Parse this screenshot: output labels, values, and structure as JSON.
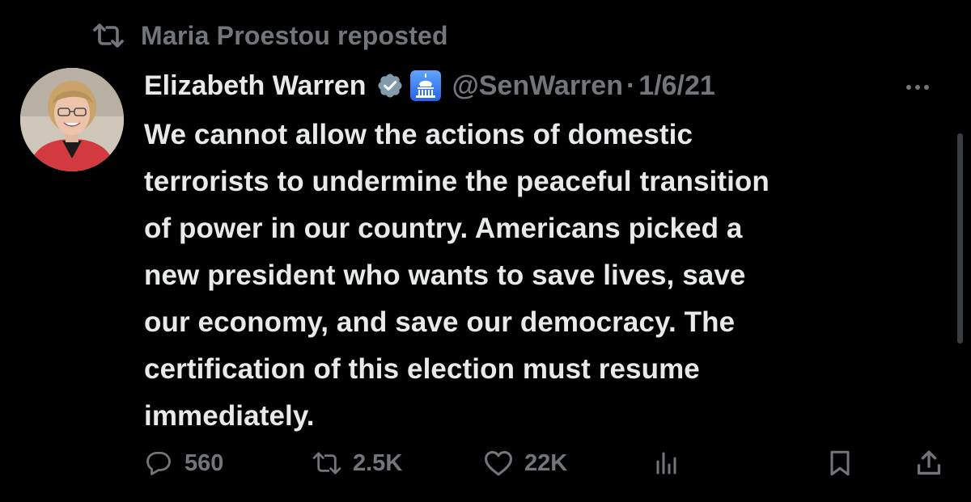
{
  "repost": {
    "icon": "repost-icon",
    "text": "Maria Proestou reposted"
  },
  "author": {
    "display_name": "Elizabeth Warren",
    "verified_icon": "verified-badge-icon",
    "affiliation_icon": "capitol-building-icon",
    "handle": "@SenWarren",
    "separator": "·",
    "date": "1/6/21"
  },
  "tweet": {
    "lines": [
      "We cannot allow the actions of domestic",
      "terrorists to undermine the peaceful transition",
      "of power in our country. Americans picked a",
      "new president who wants to save lives, save",
      "our economy, and save our democracy. The",
      "certification of this election must resume",
      "immediately."
    ]
  },
  "actions": {
    "reply": {
      "icon": "reply-icon",
      "count": "560"
    },
    "repost": {
      "icon": "repost-icon",
      "count": "2.5K"
    },
    "like": {
      "icon": "heart-icon",
      "count": "22K"
    },
    "views": {
      "icon": "views-icon"
    },
    "bookmark": {
      "icon": "bookmark-icon"
    },
    "share": {
      "icon": "share-icon"
    }
  },
  "colors": {
    "background": "#000000",
    "primary_text": "#e7e9ea",
    "secondary_text": "#71767b",
    "verified_badge": "#829aab",
    "gov_badge": "#3b82f6"
  }
}
